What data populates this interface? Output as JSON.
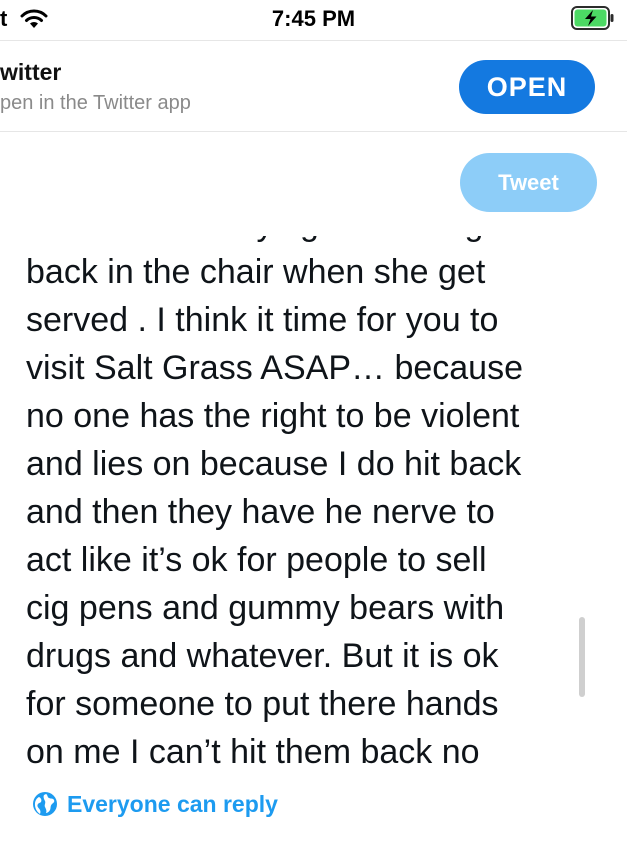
{
  "status_bar": {
    "carrier": "t",
    "time": "7:45 PM",
    "icons": [
      "wifi-icon",
      "battery-charging-icon"
    ],
    "battery_color": "#4cd964"
  },
  "banner": {
    "title": "witter",
    "subtitle": "pen in the Twitter app",
    "open_label": "OPEN",
    "open_color": "#1479e0"
  },
  "compose": {
    "tweet_label": "Tweet",
    "tweet_button_color": "#8dcdf8",
    "text": "with her fake crying and falling\nback in the chair when she get\nserved . I think it time for you to\nvisit Salt  Grass ASAP… because\nno one has the right to be violent\nand lies on because I do hit back\nand then they have he nerve to\nact like it’s ok for people to sell\ncig pens and gummy bears with\ndrugs and whatever. But it  is ok\nfor someone to put there  hands\non me I can’t hit them back no"
  },
  "reply_setting": {
    "label": "Everyone can reply",
    "icon": "globe-icon",
    "color": "#1d9bf0"
  }
}
